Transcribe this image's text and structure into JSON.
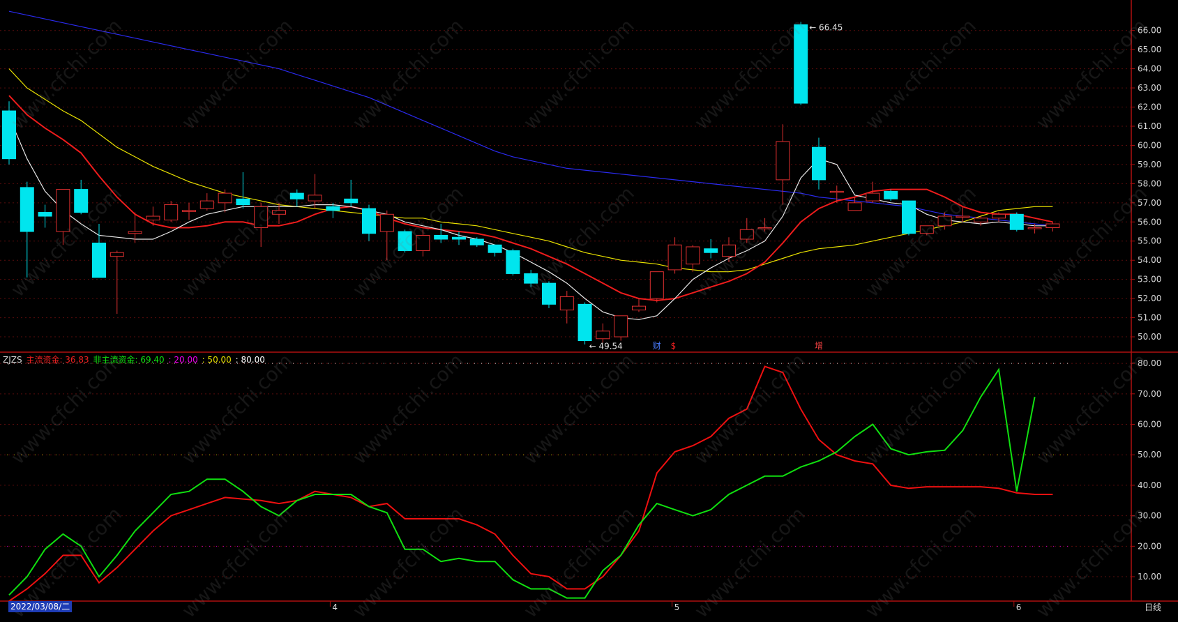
{
  "watermark": "www.cfchi.com",
  "colors": {
    "background": "#000000",
    "axis": "#b01010",
    "grid": "#5a0c0c",
    "tick_label": "#d8d8d8",
    "up_candle": "#e03030",
    "down_candle": "#00e5ee",
    "ma5": "#e8e8e8",
    "ma10": "#ee1c1c",
    "ma20": "#e8e000",
    "ma60": "#2a2aee",
    "main_fund": "#ee1010",
    "non_main_fund": "#10e010",
    "ref20": "#ee00ee",
    "ref50": "#e8e000"
  },
  "price_chart": {
    "ylim": [
      49.2,
      67.3
    ],
    "yticks": [
      "66.00",
      "65.00",
      "64.00",
      "63.00",
      "62.00",
      "61.00",
      "60.00",
      "59.00",
      "58.00",
      "57.00",
      "56.00",
      "55.00",
      "54.00",
      "53.00",
      "52.00",
      "51.00",
      "50.00"
    ],
    "high_label": "66.45",
    "low_label": "49.54",
    "event_markers": [
      {
        "index": 36,
        "text": "财",
        "color": "#4a7cff"
      },
      {
        "index": 37,
        "text": "$",
        "color": "#ee2020"
      },
      {
        "index": 45,
        "text": "增",
        "color": "#ee4040"
      }
    ],
    "candles": [
      {
        "o": 61.8,
        "c": 59.3,
        "h": 62.3,
        "l": 59.0
      },
      {
        "o": 57.8,
        "c": 55.5,
        "h": 58.1,
        "l": 53.1
      },
      {
        "o": 56.5,
        "c": 56.3,
        "h": 56.9,
        "l": 55.7
      },
      {
        "o": 55.5,
        "c": 57.7,
        "h": 57.7,
        "l": 54.8
      },
      {
        "o": 57.7,
        "c": 56.5,
        "h": 58.2,
        "l": 56.4
      },
      {
        "o": 54.9,
        "c": 53.1,
        "h": 55.9,
        "l": 53.1
      },
      {
        "o": 54.2,
        "c": 54.4,
        "h": 54.5,
        "l": 51.2
      },
      {
        "o": 55.4,
        "c": 55.5,
        "h": 56.5,
        "l": 54.9
      },
      {
        "o": 56.1,
        "c": 56.3,
        "h": 56.8,
        "l": 55.8
      },
      {
        "o": 56.1,
        "c": 56.9,
        "h": 57.1,
        "l": 56.0
      },
      {
        "o": 56.6,
        "c": 56.6,
        "h": 57.0,
        "l": 56.1
      },
      {
        "o": 56.7,
        "c": 57.1,
        "h": 57.5,
        "l": 56.6
      },
      {
        "o": 57.0,
        "c": 57.5,
        "h": 57.7,
        "l": 56.5
      },
      {
        "o": 57.2,
        "c": 56.9,
        "h": 58.6,
        "l": 56.7
      },
      {
        "o": 55.7,
        "c": 56.8,
        "h": 57.0,
        "l": 54.7
      },
      {
        "o": 56.4,
        "c": 56.6,
        "h": 57.0,
        "l": 55.9
      },
      {
        "o": 57.5,
        "c": 57.2,
        "h": 57.7,
        "l": 56.8
      },
      {
        "o": 57.1,
        "c": 57.4,
        "h": 58.5,
        "l": 56.7
      },
      {
        "o": 56.8,
        "c": 56.6,
        "h": 57.0,
        "l": 56.2
      },
      {
        "o": 57.2,
        "c": 57.0,
        "h": 58.2,
        "l": 56.8
      },
      {
        "o": 56.7,
        "c": 55.4,
        "h": 56.9,
        "l": 55.0
      },
      {
        "o": 55.5,
        "c": 56.4,
        "h": 56.6,
        "l": 54.0
      },
      {
        "o": 55.5,
        "c": 54.5,
        "h": 55.6,
        "l": 54.4
      },
      {
        "o": 54.5,
        "c": 55.3,
        "h": 55.6,
        "l": 54.2
      },
      {
        "o": 55.3,
        "c": 55.1,
        "h": 55.9,
        "l": 54.9
      },
      {
        "o": 55.2,
        "c": 55.1,
        "h": 55.5,
        "l": 54.8
      },
      {
        "o": 55.1,
        "c": 54.8,
        "h": 55.2,
        "l": 54.7
      },
      {
        "o": 54.8,
        "c": 54.4,
        "h": 54.8,
        "l": 54.2
      },
      {
        "o": 54.5,
        "c": 53.3,
        "h": 54.6,
        "l": 53.2
      },
      {
        "o": 53.3,
        "c": 52.8,
        "h": 53.5,
        "l": 52.6
      },
      {
        "o": 52.8,
        "c": 51.7,
        "h": 52.9,
        "l": 51.5
      },
      {
        "o": 51.4,
        "c": 52.1,
        "h": 52.4,
        "l": 50.7
      },
      {
        "o": 51.7,
        "c": 49.8,
        "h": 51.8,
        "l": 49.6
      },
      {
        "o": 49.9,
        "c": 50.3,
        "h": 50.7,
        "l": 49.7
      },
      {
        "o": 50.0,
        "c": 51.1,
        "h": 51.1,
        "l": 49.8
      },
      {
        "o": 51.4,
        "c": 51.6,
        "h": 52.0,
        "l": 51.3
      },
      {
        "o": 52.0,
        "c": 53.4,
        "h": 53.4,
        "l": 51.8
      },
      {
        "o": 53.5,
        "c": 54.8,
        "h": 55.2,
        "l": 53.3
      },
      {
        "o": 53.8,
        "c": 54.7,
        "h": 54.8,
        "l": 53.4
      },
      {
        "o": 54.6,
        "c": 54.4,
        "h": 55.1,
        "l": 54.1
      },
      {
        "o": 54.2,
        "c": 54.8,
        "h": 55.2,
        "l": 53.9
      },
      {
        "o": 55.1,
        "c": 55.6,
        "h": 56.2,
        "l": 54.9
      },
      {
        "o": 55.7,
        "c": 55.7,
        "h": 56.2,
        "l": 55.5
      },
      {
        "o": 58.2,
        "c": 60.2,
        "h": 61.1,
        "l": 56.9
      },
      {
        "o": 66.3,
        "c": 62.2,
        "h": 66.45,
        "l": 62.1
      },
      {
        "o": 59.9,
        "c": 58.2,
        "h": 60.4,
        "l": 57.7
      },
      {
        "o": 57.6,
        "c": 57.6,
        "h": 57.9,
        "l": 57.0
      },
      {
        "o": 56.6,
        "c": 57.0,
        "h": 57.3,
        "l": 56.6
      },
      {
        "o": 57.1,
        "c": 57.5,
        "h": 58.1,
        "l": 57.0
      },
      {
        "o": 57.6,
        "c": 57.2,
        "h": 57.7,
        "l": 57.1
      },
      {
        "o": 57.1,
        "c": 55.4,
        "h": 57.1,
        "l": 55.3
      },
      {
        "o": 55.4,
        "c": 55.8,
        "h": 55.8,
        "l": 55.3
      },
      {
        "o": 55.8,
        "c": 56.3,
        "h": 56.5,
        "l": 55.6
      },
      {
        "o": 56.3,
        "c": 56.3,
        "h": 56.8,
        "l": 56.0
      },
      {
        "o": 56.0,
        "c": 56.2,
        "h": 56.3,
        "l": 55.8
      },
      {
        "o": 56.2,
        "c": 56.4,
        "h": 56.5,
        "l": 56.0
      },
      {
        "o": 56.4,
        "c": 55.6,
        "h": 56.5,
        "l": 55.5
      },
      {
        "o": 55.7,
        "c": 55.7,
        "h": 55.9,
        "l": 55.4
      },
      {
        "o": 55.7,
        "c": 55.9,
        "h": 56.0,
        "l": 55.5
      }
    ],
    "ma5": [
      61.5,
      59.3,
      57.6,
      56.6,
      55.9,
      55.3,
      55.2,
      55.1,
      55.1,
      55.5,
      56.0,
      56.4,
      56.6,
      56.8,
      56.8,
      56.8,
      56.8,
      56.9,
      56.9,
      56.8,
      56.6,
      56.4,
      56.0,
      55.8,
      55.6,
      55.3,
      55.1,
      54.8,
      54.4,
      53.9,
      53.4,
      52.8,
      52.0,
      51.3,
      51.0,
      50.9,
      51.1,
      52.0,
      53.0,
      53.6,
      54.1,
      54.5,
      55.0,
      56.3,
      58.3,
      59.3,
      59.0,
      57.4,
      57.2,
      57.0,
      56.9,
      56.4,
      56.1,
      56.0,
      55.9,
      56.0,
      55.9,
      55.8,
      55.8
    ],
    "ma10": [
      62.6,
      61.6,
      60.9,
      60.3,
      59.6,
      58.4,
      57.3,
      56.4,
      55.9,
      55.7,
      55.7,
      55.8,
      56.0,
      56.0,
      55.8,
      55.8,
      56.0,
      56.4,
      56.7,
      56.8,
      56.6,
      56.2,
      55.9,
      55.7,
      55.6,
      55.5,
      55.4,
      55.2,
      54.9,
      54.6,
      54.2,
      53.8,
      53.3,
      52.8,
      52.3,
      52.0,
      51.9,
      52.0,
      52.3,
      52.6,
      52.9,
      53.3,
      53.9,
      54.9,
      56.0,
      56.7,
      57.1,
      57.3,
      57.6,
      57.7,
      57.7,
      57.7,
      57.3,
      56.8,
      56.5,
      56.4,
      56.4,
      56.2,
      56.0
    ],
    "ma20": [
      64.0,
      63.0,
      62.4,
      61.8,
      61.3,
      60.6,
      59.9,
      59.4,
      58.9,
      58.5,
      58.1,
      57.8,
      57.5,
      57.3,
      57.1,
      56.9,
      56.8,
      56.7,
      56.6,
      56.5,
      56.4,
      56.3,
      56.2,
      56.2,
      56.0,
      55.9,
      55.8,
      55.6,
      55.4,
      55.2,
      55.0,
      54.7,
      54.4,
      54.2,
      54.0,
      53.9,
      53.8,
      53.6,
      53.5,
      53.4,
      53.4,
      53.5,
      53.8,
      54.1,
      54.4,
      54.6,
      54.7,
      54.8,
      55.0,
      55.2,
      55.4,
      55.6,
      55.8,
      56.0,
      56.3,
      56.6,
      56.7,
      56.8,
      56.8
    ],
    "ma60": [
      67.0,
      66.8,
      66.6,
      66.4,
      66.2,
      66.0,
      65.8,
      65.6,
      65.4,
      65.2,
      65.0,
      64.8,
      64.6,
      64.4,
      64.2,
      64.0,
      63.7,
      63.4,
      63.1,
      62.8,
      62.5,
      62.1,
      61.7,
      61.3,
      60.9,
      60.5,
      60.1,
      59.7,
      59.4,
      59.2,
      59.0,
      58.8,
      58.7,
      58.6,
      58.5,
      58.4,
      58.3,
      58.2,
      58.1,
      58.0,
      57.9,
      57.8,
      57.7,
      57.6,
      57.5,
      57.3,
      57.2,
      57.1,
      57.0,
      56.9,
      56.8,
      56.6,
      56.4,
      56.3,
      56.2,
      56.1,
      56.0,
      55.9,
      55.8
    ]
  },
  "indicator": {
    "header": [
      {
        "text": "ZJZS",
        "color": "#d8d8d8"
      },
      {
        "text": "主流资金: 36.83",
        "color": "#ee2020"
      },
      {
        "text": "非主流资金: 69.40",
        "color": "#10e010"
      },
      {
        "text": ": 20.00",
        "color": "#ee00ee"
      },
      {
        "text": ": 50.00",
        "color": "#e8e000"
      },
      {
        "text": ": 80.00",
        "color": "#ffffff"
      }
    ],
    "ylim": [
      2,
      83
    ],
    "yticks": [
      "80.00",
      "70.00",
      "60.00",
      "50.00",
      "40.00",
      "30.00",
      "20.00",
      "10.00"
    ],
    "main_fund": [
      2,
      6,
      11,
      17,
      17,
      8,
      13,
      19,
      25,
      30,
      32,
      34,
      36,
      35.5,
      35,
      34,
      35,
      38,
      37,
      36,
      33,
      34,
      29,
      29,
      29,
      29,
      27,
      24,
      17,
      11,
      10,
      6,
      6,
      10,
      17,
      25,
      44,
      51,
      53,
      56,
      62,
      65,
      79,
      77,
      65,
      55,
      50,
      48,
      47,
      40,
      39,
      39.5,
      39.5,
      39.5,
      39.5,
      39,
      37.5,
      37,
      37
    ],
    "non_main_fund": [
      4,
      10,
      19,
      24,
      20,
      10,
      17,
      25,
      31,
      37,
      38,
      42,
      42,
      38,
      33,
      30,
      35,
      37,
      37,
      37,
      33,
      31,
      19,
      19,
      15,
      16,
      15,
      15,
      9,
      6,
      6,
      3,
      3,
      12,
      17,
      27,
      34,
      32,
      30,
      32,
      37,
      40,
      43,
      43,
      46,
      48,
      51,
      56,
      60,
      52,
      50,
      51,
      51.5,
      58,
      69,
      78,
      38,
      69
    ]
  },
  "x_axis": {
    "date_label": "2022/03/08/二",
    "month_marks": [
      {
        "index": 18,
        "text": "4"
      },
      {
        "index": 37,
        "text": "5"
      },
      {
        "index": 56,
        "text": "6"
      }
    ],
    "period_label": "日线"
  }
}
